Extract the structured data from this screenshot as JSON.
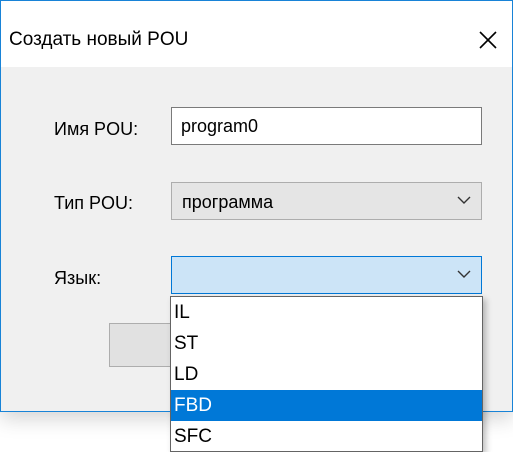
{
  "dialog": {
    "title": "Создать новый POU"
  },
  "form": {
    "name_label": "Имя POU:",
    "name_value": "program0",
    "type_label": "Тип POU:",
    "type_value": "программа",
    "language_label": "Язык:",
    "language_value": ""
  },
  "language_dropdown": {
    "options": [
      "IL",
      "ST",
      "LD",
      "FBD",
      "SFC"
    ],
    "highlighted": "FBD"
  },
  "colors": {
    "accent": "#0078d7",
    "window_border": "#1883d7",
    "combo_focus_bg": "#cce4f7"
  },
  "icons": {
    "close": "close-icon",
    "chevron": "chevron-down-icon"
  }
}
